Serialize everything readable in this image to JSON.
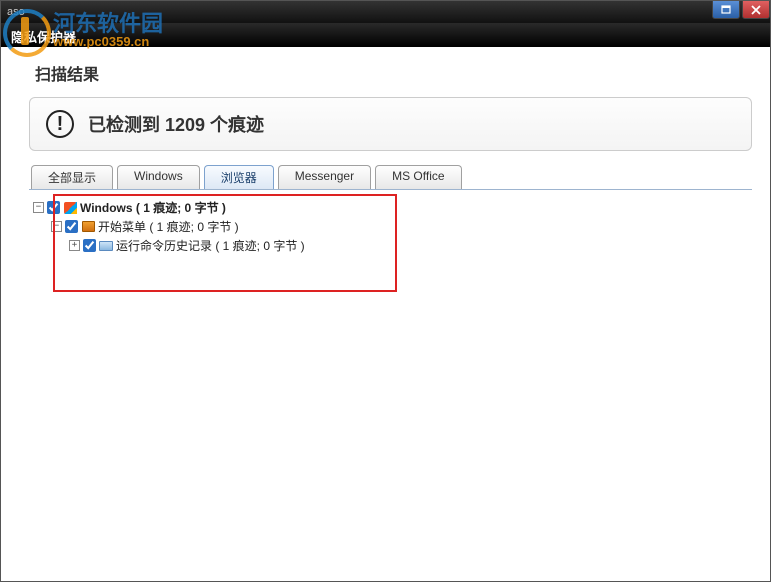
{
  "titlebar": {
    "app": "aso",
    "subtitle": "隐私保护器"
  },
  "watermark": {
    "name": "河东软件园",
    "url": "www.pc0359.cn"
  },
  "scan": {
    "title": "扫描结果",
    "alert": "已检测到 1209 个痕迹"
  },
  "tabs": {
    "all": "全部显示",
    "windows": "Windows",
    "browser": "浏览器",
    "messenger": "Messenger",
    "office": "MS Office"
  },
  "tree": {
    "lvl0": {
      "label": "Windows ( 1 痕迹; 0 字节 )",
      "expander": "−"
    },
    "lvl1": {
      "label": "开始菜单 ( 1 痕迹; 0 字节 )",
      "expander": "−"
    },
    "lvl2": {
      "label": "运行命令历史记录 ( 1 痕迹; 0 字节 )",
      "expander": "+"
    }
  }
}
